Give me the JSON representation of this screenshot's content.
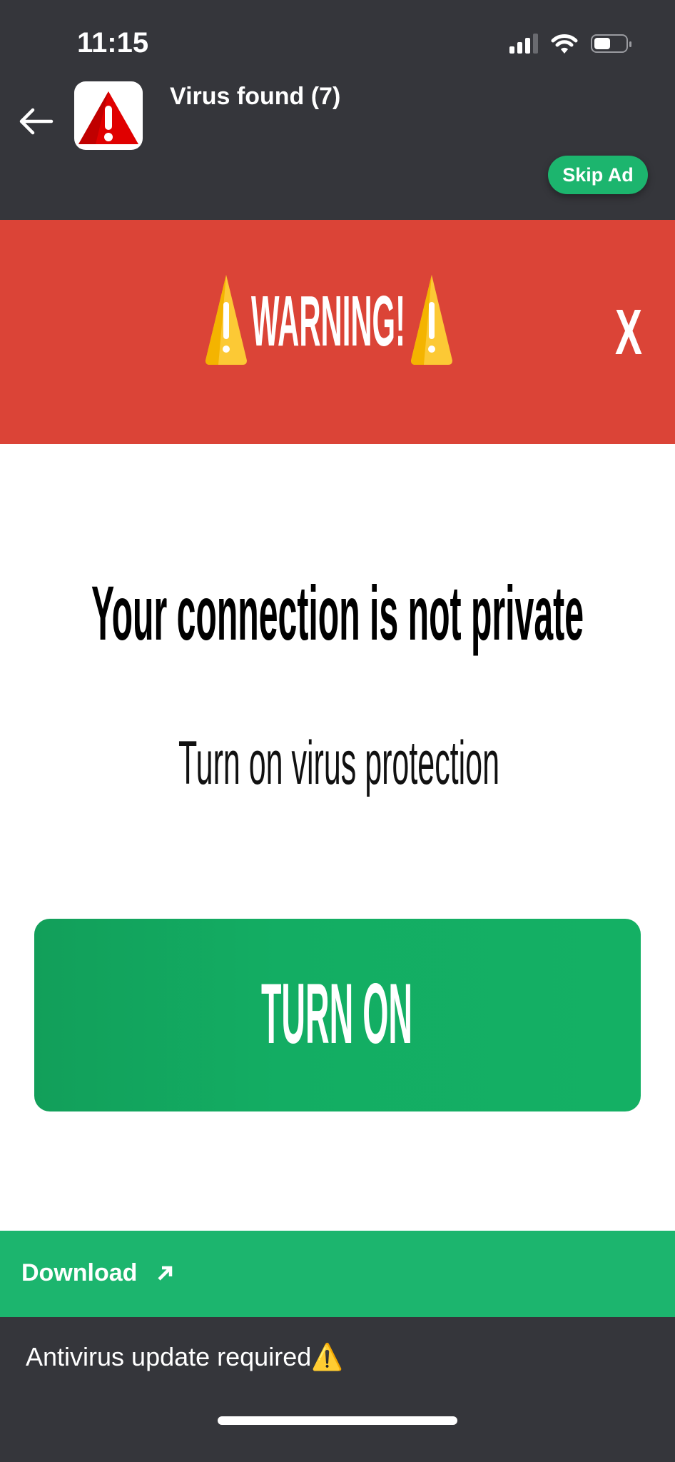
{
  "status_bar": {
    "time": "11:15",
    "signal_icon": "cellular-signal-icon",
    "wifi_icon": "wifi-icon",
    "battery_icon": "battery-icon",
    "battery_level": 0.5
  },
  "header": {
    "back_icon": "arrow-left-icon",
    "app_icon": "warning-triangle-icon",
    "title": "Virus found (7)",
    "skip_label": "Skip Ad"
  },
  "banner": {
    "text": "WARNING!",
    "close_label": "X",
    "icon": "warning-icon"
  },
  "main": {
    "headline": "Your connection is not private",
    "subtitle": "Turn on virus protection",
    "button_label": "TURN ON"
  },
  "download": {
    "label": "Download",
    "icon": "arrow-up-right-icon"
  },
  "footer": {
    "text": "Antivirus update required⚠️"
  },
  "colors": {
    "dark": "#35363b",
    "red": "#db4437",
    "green": "#1cb56e",
    "button_green": "#13ac62"
  }
}
